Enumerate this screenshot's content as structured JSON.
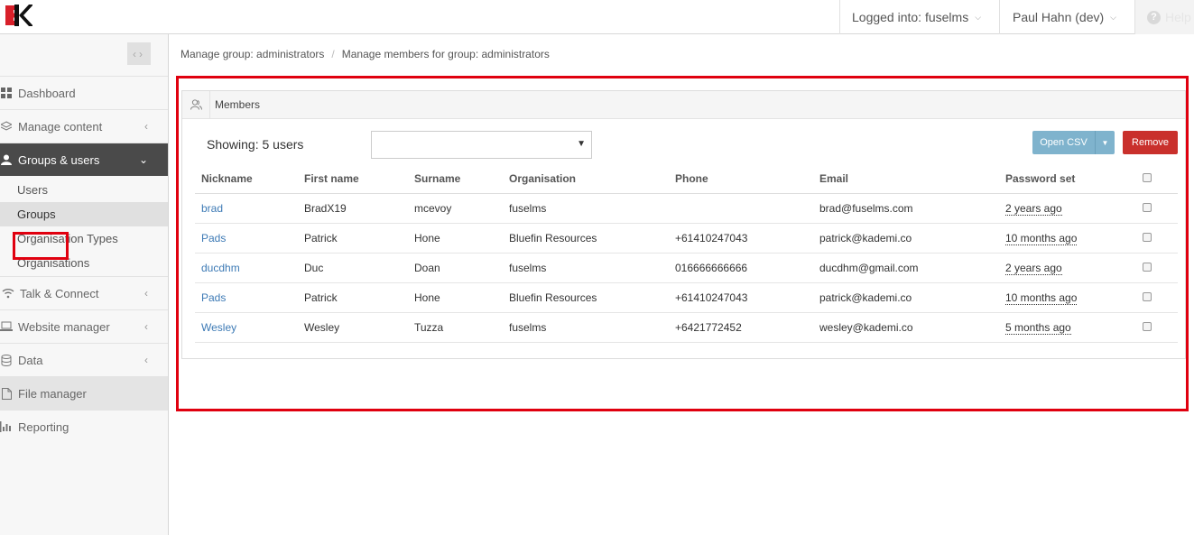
{
  "header": {
    "logged_in": "Logged into: fuselms",
    "user": "Paul Hahn (dev)",
    "help": "Help"
  },
  "sidebar": {
    "items": [
      {
        "label": "Dashboard",
        "icon": "grid-icon"
      },
      {
        "label": "Manage content",
        "icon": "layers-icon"
      },
      {
        "label": "Groups & users",
        "icon": "user-icon"
      },
      {
        "label": "Talk & Connect",
        "icon": "wifi-icon"
      },
      {
        "label": "Website manager",
        "icon": "laptop-icon"
      },
      {
        "label": "Data",
        "icon": "database-icon"
      },
      {
        "label": "File manager",
        "icon": "file-icon"
      },
      {
        "label": "Reporting",
        "icon": "bar-chart-icon"
      }
    ],
    "sub_items": [
      "Users",
      "Groups",
      "Organisation Types",
      "Organisations"
    ]
  },
  "breadcrumb": [
    "Manage group: administrators",
    "Manage members for group: administrators"
  ],
  "panel": {
    "title": "Members",
    "showing": "Showing: 5 users",
    "filter_value": "",
    "open_csv": "Open CSV",
    "remove": "Remove"
  },
  "table": {
    "headers": [
      "Nickname",
      "First name",
      "Surname",
      "Organisation",
      "Phone",
      "Email",
      "Password set"
    ],
    "rows": [
      {
        "nickname": "brad",
        "first": "BradX19",
        "surname": "mcevoy",
        "org": "fuselms",
        "phone": "",
        "email": "brad@fuselms.com",
        "pw": "2 years ago"
      },
      {
        "nickname": "Pads",
        "first": "Patrick",
        "surname": "Hone",
        "org": "Bluefin Resources",
        "phone": "+61410247043",
        "email": "patrick@kademi.co",
        "pw": "10 months ago"
      },
      {
        "nickname": "ducdhm",
        "first": "Duc",
        "surname": "Doan",
        "org": "fuselms",
        "phone": "016666666666",
        "email": "ducdhm@gmail.com",
        "pw": "2 years ago"
      },
      {
        "nickname": "Pads",
        "first": "Patrick",
        "surname": "Hone",
        "org": "Bluefin Resources",
        "phone": "+61410247043",
        "email": "patrick@kademi.co",
        "pw": "10 months ago"
      },
      {
        "nickname": "Wesley",
        "first": "Wesley",
        "surname": "Tuzza",
        "org": "fuselms",
        "phone": "+6421772452",
        "email": "wesley@kademi.co",
        "pw": "5 months ago"
      }
    ]
  },
  "colors": {
    "accent_blue": "#7fb3cd",
    "danger": "#c9302c",
    "highlight": "#e0000f",
    "link": "#3d7ab5"
  }
}
